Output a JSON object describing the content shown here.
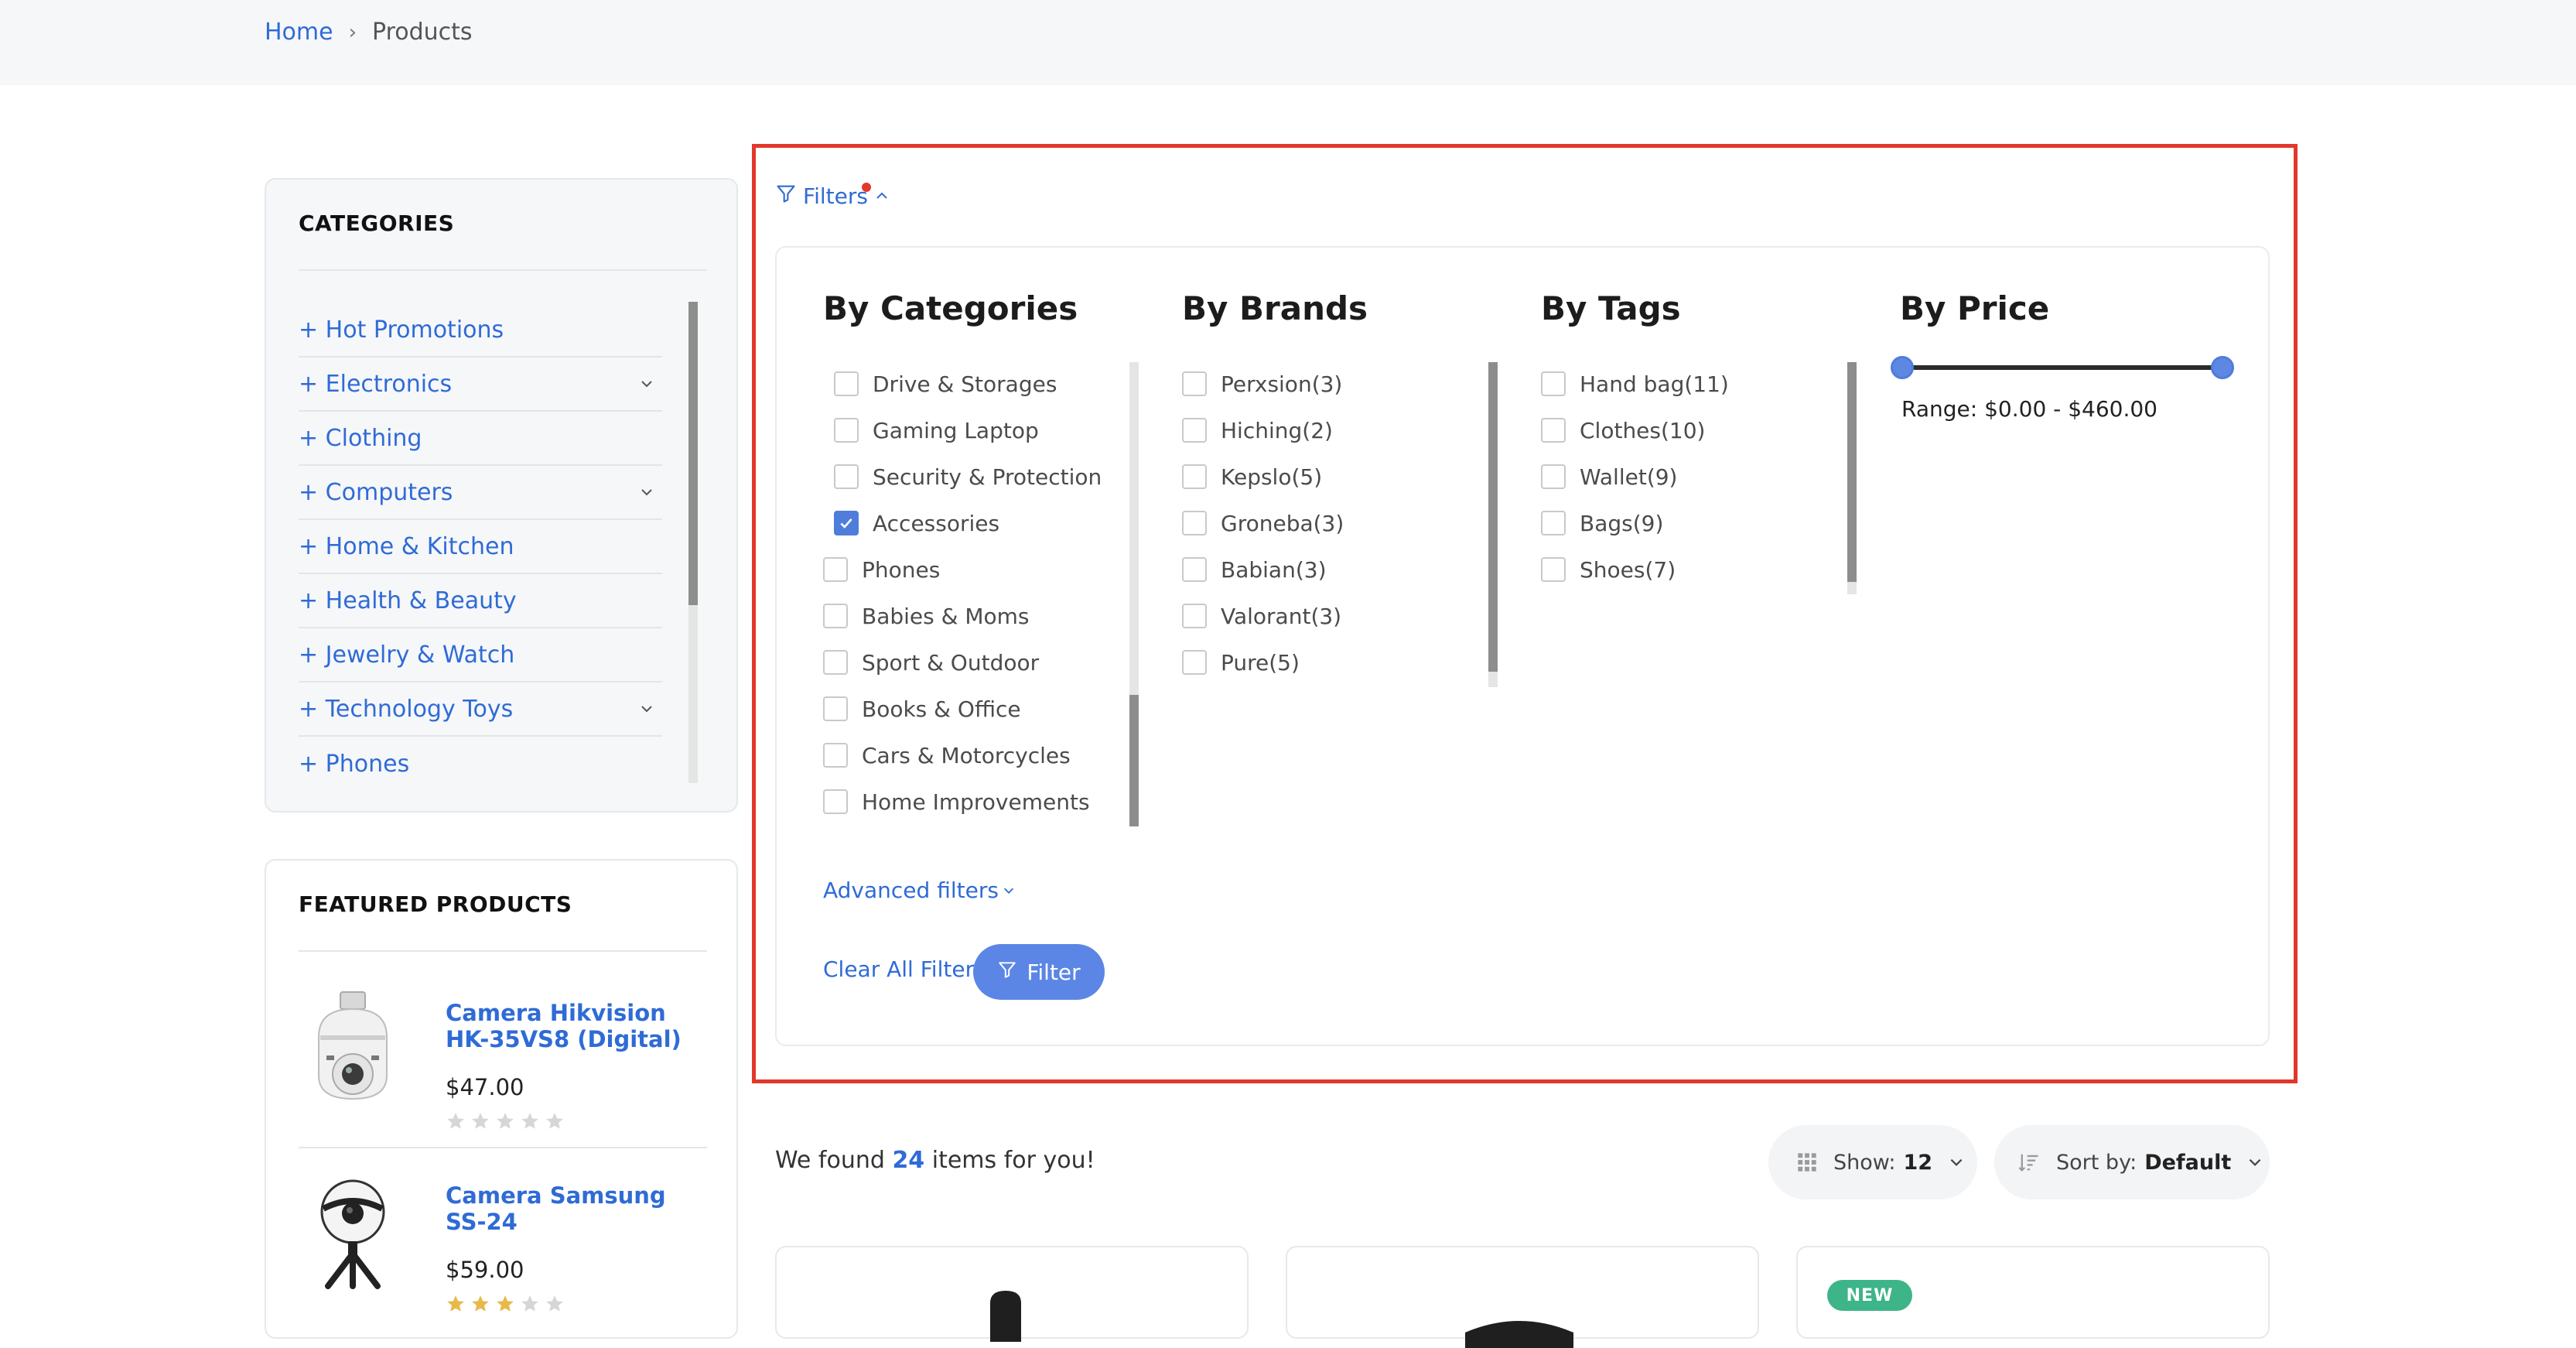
{
  "breadcrumb": {
    "home": "Home",
    "separator": "›",
    "current": "Products"
  },
  "sidebar": {
    "categories_title": "CATEGORIES",
    "categories": [
      {
        "label": "+ Hot Promotions",
        "expandable": false
      },
      {
        "label": "+ Electronics",
        "expandable": true
      },
      {
        "label": "+ Clothing",
        "expandable": false
      },
      {
        "label": "+ Computers",
        "expandable": true
      },
      {
        "label": "+ Home & Kitchen",
        "expandable": false
      },
      {
        "label": "+ Health & Beauty",
        "expandable": false
      },
      {
        "label": "+ Jewelry & Watch",
        "expandable": false
      },
      {
        "label": "+ Technology Toys",
        "expandable": true
      },
      {
        "label": "+ Phones",
        "expandable": false
      }
    ],
    "featured_title": "FEATURED PRODUCTS",
    "featured": [
      {
        "name": "Camera Hikvision HK-35VS8 (Digital)",
        "price": "$47.00",
        "rating": 0
      },
      {
        "name": "Camera Samsung SS-24",
        "price": "$59.00",
        "rating": 3
      }
    ]
  },
  "filters": {
    "toggle_label": "Filters",
    "has_active": true,
    "categories": {
      "title": "By Categories",
      "items": [
        {
          "label": "Drive & Storages",
          "checked": false
        },
        {
          "label": "Gaming Laptop",
          "checked": false
        },
        {
          "label": "Security & Protection",
          "checked": false
        },
        {
          "label": "Accessories",
          "checked": true
        },
        {
          "label": "Phones",
          "checked": false
        },
        {
          "label": "Babies & Moms",
          "checked": false
        },
        {
          "label": "Sport & Outdoor",
          "checked": false
        },
        {
          "label": "Books & Office",
          "checked": false
        },
        {
          "label": "Cars & Motorcycles",
          "checked": false
        },
        {
          "label": "Home Improvements",
          "checked": false
        }
      ]
    },
    "brands": {
      "title": "By Brands",
      "items": [
        {
          "label": "Perxsion(3)",
          "checked": false
        },
        {
          "label": "Hiching(2)",
          "checked": false
        },
        {
          "label": "Kepslo(5)",
          "checked": false
        },
        {
          "label": "Groneba(3)",
          "checked": false
        },
        {
          "label": "Babian(3)",
          "checked": false
        },
        {
          "label": "Valorant(3)",
          "checked": false
        },
        {
          "label": "Pure(5)",
          "checked": false
        }
      ]
    },
    "tags": {
      "title": "By Tags",
      "items": [
        {
          "label": "Hand bag(11)",
          "checked": false
        },
        {
          "label": "Clothes(10)",
          "checked": false
        },
        {
          "label": "Wallet(9)",
          "checked": false
        },
        {
          "label": "Bags(9)",
          "checked": false
        },
        {
          "label": "Shoes(7)",
          "checked": false
        }
      ]
    },
    "price": {
      "title": "By Price",
      "range_label": "Range:",
      "min": "$0.00",
      "dash": "-",
      "max": "$460.00"
    },
    "advanced_label": "Advanced filters",
    "clear_label": "Clear All Filter",
    "apply_label": "Filter"
  },
  "results": {
    "found_prefix": "We found",
    "count": "24",
    "found_suffix": "items for you!",
    "show_label": "Show:",
    "show_value": "12",
    "sort_label": "Sort by:",
    "sort_value": "Default",
    "badge": "NEW"
  },
  "colors": {
    "accent": "#2f6bd6",
    "button": "#5b86e5",
    "highlight": "#e2372b",
    "badge": "#3eb489"
  }
}
